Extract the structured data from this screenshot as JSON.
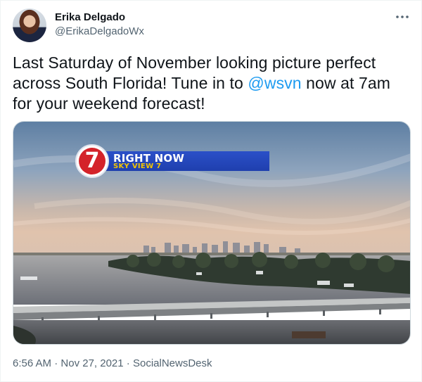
{
  "author": {
    "display_name": "Erika Delgado",
    "handle": "@ErikaDelgadoWx"
  },
  "more_icon": "more-horizontal-icon",
  "tweet": {
    "text_before": "Last Saturday of November looking picture perfect across South Florida! Tune in to ",
    "mention": "@wsvn",
    "text_after": " now at 7am for your weekend forecast!"
  },
  "media": {
    "banner_title": "RIGHT NOW",
    "banner_subtitle": "SKY VIEW 7",
    "logo_text": "7"
  },
  "meta": {
    "time": "6:56 AM",
    "separator1": " · ",
    "date": "Nov 27, 2021",
    "separator2": " · ",
    "source": "SocialNewsDesk"
  },
  "colors": {
    "accent": "#1d9bf0",
    "text_primary": "#0f1419",
    "text_secondary": "#536471",
    "banner_blue": "#1f3fae",
    "banner_yellow": "#f3c400",
    "logo_red": "#d4232a"
  }
}
